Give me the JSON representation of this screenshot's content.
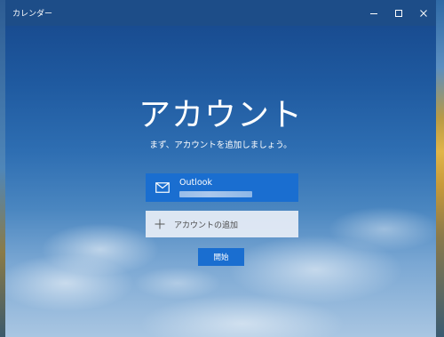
{
  "window": {
    "title": "カレンダー"
  },
  "main": {
    "heading": "アカウント",
    "subheading": "まず、アカウントを追加しましょう。",
    "accounts": [
      {
        "provider": "Outlook",
        "icon": "mail-icon"
      }
    ],
    "add_account_label": "アカウントの追加",
    "start_button_label": "開始"
  },
  "colors": {
    "accent": "#1a6ed0",
    "titlebar": "#1d4d88"
  }
}
